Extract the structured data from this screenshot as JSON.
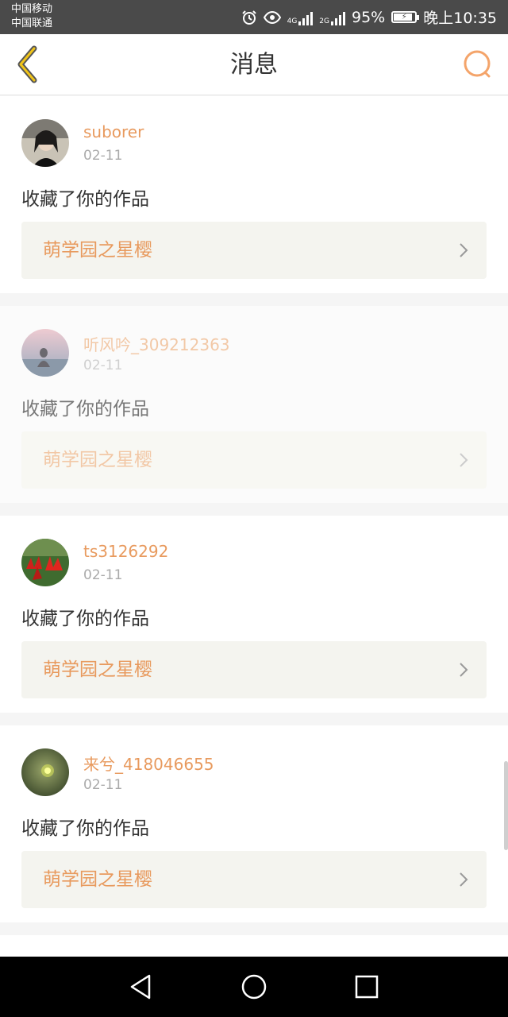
{
  "status_bar": {
    "carrier_1": "中国移动",
    "carrier_2": "中国联通",
    "net_1": "4G",
    "net_2": "2G",
    "battery": "95%",
    "battery_level": 0.95,
    "time": "晚上10:35"
  },
  "header": {
    "title": "消息",
    "back_icon": "chevron-left-icon",
    "search_icon": "search-icon"
  },
  "colors": {
    "accent": "#e89a5e",
    "status_bar": "#4a4a4a",
    "work_bg": "#f4f4ef"
  },
  "messages": [
    {
      "username": "suborer",
      "date": "02-11",
      "action": "收藏了你的作品",
      "work_title": "萌学园之星樱",
      "faded": false
    },
    {
      "username": "听风吟_309212363",
      "date": "02-11",
      "action": "收藏了你的作品",
      "work_title": "萌学园之星樱",
      "faded": true
    },
    {
      "username": "ts3126292",
      "date": "02-11",
      "action": "收藏了你的作品",
      "work_title": "萌学园之星樱",
      "faded": false
    },
    {
      "username": "来兮_418046655",
      "date": "02-11",
      "action": "收藏了你的作品",
      "work_title": "萌学园之星樱",
      "faded": false
    }
  ],
  "nav": {
    "back_icon": "triangle-back-icon",
    "home_icon": "circle-home-icon",
    "recents_icon": "square-recents-icon"
  }
}
